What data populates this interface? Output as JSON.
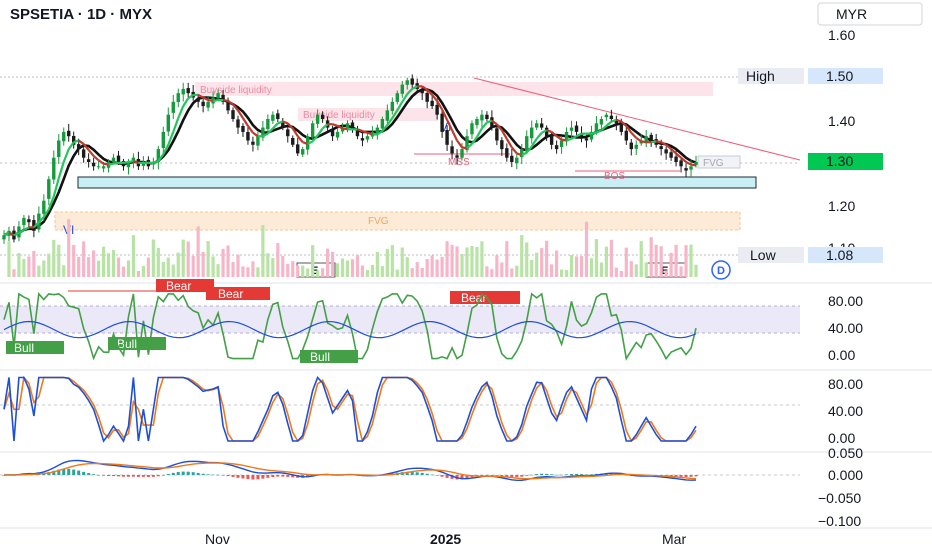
{
  "header": {
    "title": "SPSETIA · 1D · MYX",
    "currency": "MYR"
  },
  "colors": {
    "up": "#22c55e",
    "down": "#c0392b",
    "blue": "#1e4fd8",
    "orange": "#f07a1a",
    "pink": "#f4a7b9",
    "price_tag": "#00c853"
  },
  "price_panel": {
    "ylim": [
      1.05,
      1.65
    ],
    "ticks": [
      {
        "value": 1.6,
        "label": "1.60"
      },
      {
        "value": 1.4,
        "label": "1.40"
      },
      {
        "value": 1.2,
        "label": "1.20"
      },
      {
        "value": 1.1,
        "label": "1.10"
      }
    ],
    "high": {
      "label": "High",
      "value": 1.5,
      "text": "1.50"
    },
    "low": {
      "label": "Low",
      "value": 1.08,
      "text": "1.08"
    },
    "last": {
      "value": 1.3,
      "text": "1.30"
    }
  },
  "annotations": {
    "buyside1": "Buyside liquidity",
    "buyside2": "Buyside liquidity",
    "fvg": "FVG",
    "fvg_right": "FVG",
    "vi1": "VI",
    "vi2": "VI",
    "mss": "MSS",
    "bos": "BOS",
    "earnings": "E",
    "dividend": "D",
    "bull": "Bull",
    "bear": "Bear"
  },
  "osc_panel": {
    "ticks": [
      {
        "value": 80,
        "label": "80.00"
      },
      {
        "value": 40,
        "label": "40.00"
      },
      {
        "value": 0,
        "label": "0.00"
      }
    ]
  },
  "stoch_panel": {
    "ticks": [
      {
        "value": 80,
        "label": "80.00"
      },
      {
        "value": 40,
        "label": "40.00"
      },
      {
        "value": 0,
        "label": "0.00"
      }
    ]
  },
  "macd_panel": {
    "ticks": [
      {
        "value": 0.05,
        "label": "0.050"
      },
      {
        "value": 0,
        "label": "0.000"
      },
      {
        "value": -0.05,
        "label": "−0.050"
      },
      {
        "value": -0.1,
        "label": "−0.100"
      }
    ]
  },
  "time_axis": [
    {
      "label": "Nov",
      "bold": false
    },
    {
      "label": "2025",
      "bold": true
    },
    {
      "label": "Mar",
      "bold": false
    }
  ],
  "chart_data": {
    "type": "candlestick",
    "n_bars": 140,
    "x_labels": [
      "Nov",
      "2025",
      "Mar"
    ],
    "close": [
      1.13,
      1.14,
      1.12,
      1.15,
      1.17,
      1.16,
      1.14,
      1.18,
      1.21,
      1.26,
      1.31,
      1.35,
      1.37,
      1.36,
      1.34,
      1.33,
      1.31,
      1.3,
      1.29,
      1.29,
      1.29,
      1.3,
      1.31,
      1.3,
      1.29,
      1.3,
      1.31,
      1.29,
      1.3,
      1.29,
      1.3,
      1.33,
      1.37,
      1.41,
      1.44,
      1.46,
      1.47,
      1.46,
      1.45,
      1.44,
      1.43,
      1.44,
      1.45,
      1.46,
      1.44,
      1.42,
      1.4,
      1.38,
      1.37,
      1.35,
      1.34,
      1.36,
      1.38,
      1.4,
      1.41,
      1.4,
      1.38,
      1.36,
      1.34,
      1.32,
      1.33,
      1.36,
      1.39,
      1.41,
      1.4,
      1.38,
      1.36,
      1.37,
      1.38,
      1.39,
      1.38,
      1.36,
      1.35,
      1.36,
      1.37,
      1.38,
      1.4,
      1.42,
      1.44,
      1.46,
      1.48,
      1.49,
      1.48,
      1.47,
      1.46,
      1.44,
      1.43,
      1.41,
      1.37,
      1.34,
      1.32,
      1.31,
      1.33,
      1.36,
      1.39,
      1.4,
      1.41,
      1.4,
      1.38,
      1.35,
      1.33,
      1.31,
      1.3,
      1.31,
      1.33,
      1.36,
      1.38,
      1.39,
      1.38,
      1.36,
      1.34,
      1.33,
      1.35,
      1.37,
      1.38,
      1.37,
      1.36,
      1.35,
      1.37,
      1.39,
      1.4,
      1.41,
      1.4,
      1.39,
      1.37,
      1.35,
      1.33,
      1.34,
      1.35,
      1.36,
      1.35,
      1.34,
      1.33,
      1.32,
      1.31,
      1.3,
      1.29,
      1.28,
      1.29,
      1.3
    ]
  }
}
